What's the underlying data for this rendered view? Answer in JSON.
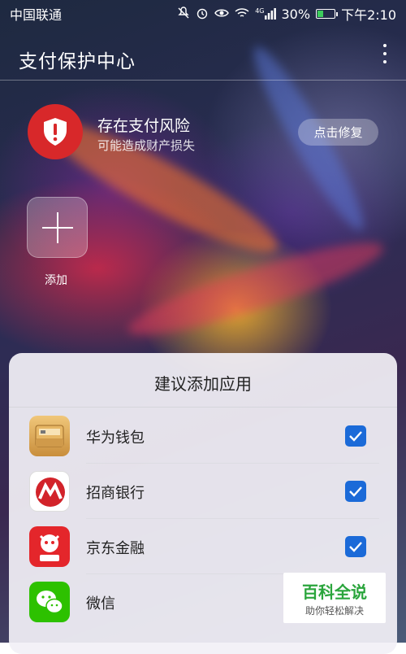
{
  "status_bar": {
    "carrier": "中国联通",
    "network": "4G",
    "battery": "30%",
    "time": "下午2:10"
  },
  "header": {
    "title": "支付保护中心",
    "menu_icon": "more-vertical-icon"
  },
  "risk": {
    "icon": "shield-alert-icon",
    "title": "存在支付风险",
    "subtitle": "可能造成财产损失",
    "fix_label": "点击修复"
  },
  "add": {
    "icon": "plus-icon",
    "label": "添加"
  },
  "sheet": {
    "title": "建议添加应用",
    "apps": [
      {
        "name": "华为钱包",
        "icon": "huawei-wallet-icon",
        "checked": true
      },
      {
        "name": "招商银行",
        "icon": "cmb-bank-icon",
        "checked": true
      },
      {
        "name": "京东金融",
        "icon": "jd-finance-icon",
        "checked": true
      },
      {
        "name": "微信",
        "icon": "wechat-icon",
        "checked": false
      }
    ]
  },
  "watermark": {
    "title": "百科全说",
    "subtitle": "助你轻松解决"
  },
  "colors": {
    "accent_blue": "#1b6ad8",
    "risk_red": "#d8282a",
    "watermark_green": "#2aa53c"
  }
}
